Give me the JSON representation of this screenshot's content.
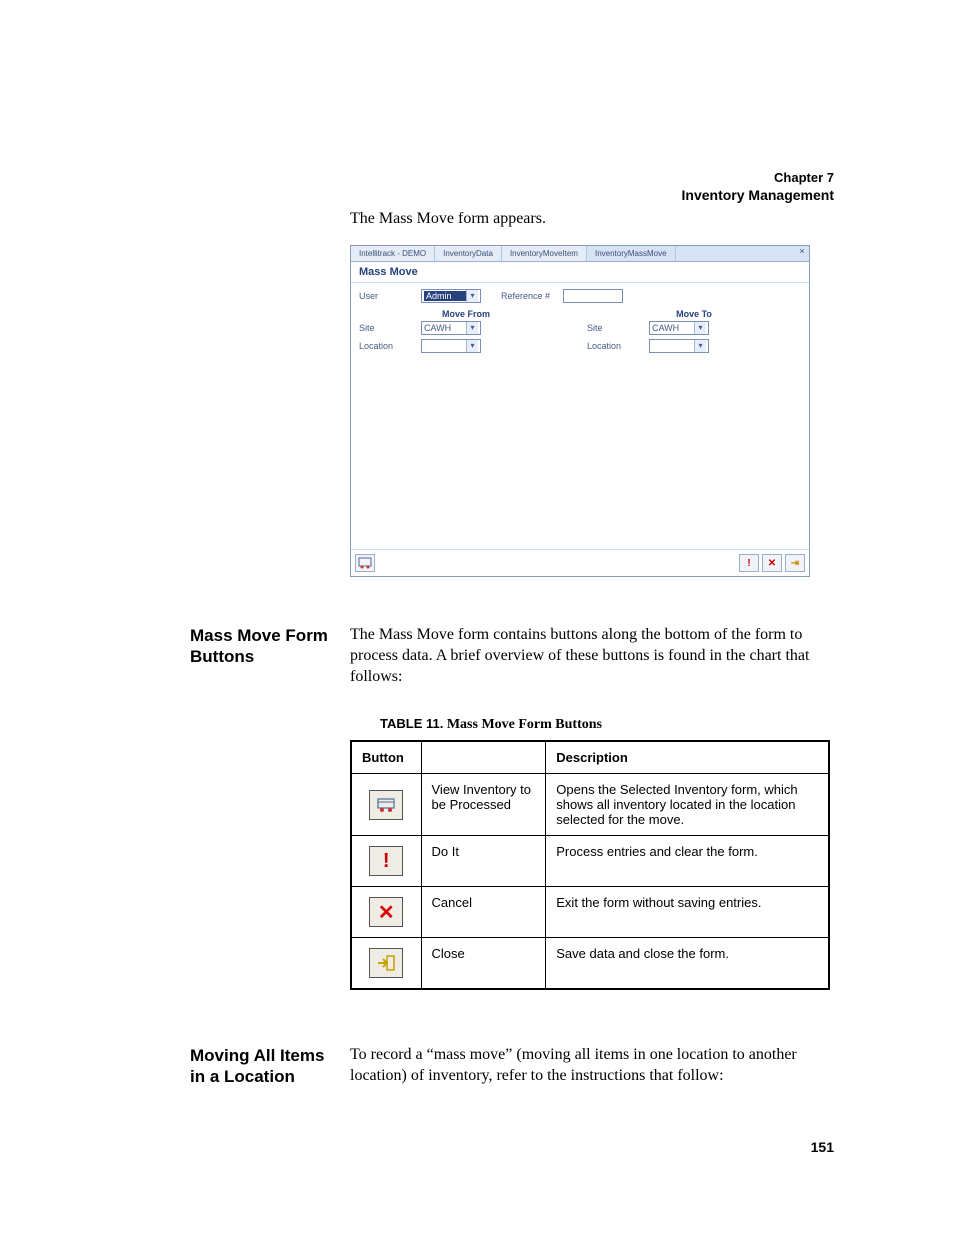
{
  "header": {
    "line1": "Chapter 7",
    "line2": "Inventory Management"
  },
  "intro_text": "The Mass Move form appears.",
  "screenshot": {
    "tabs": [
      "Intellitrack - DEMO",
      "InventoryData",
      "InventoryMoveItem",
      "InventoryMassMove"
    ],
    "active_tab_index": 3,
    "title": "Mass Move",
    "fields": {
      "user_label": "User",
      "user_value": "Admin",
      "reference_label": "Reference #",
      "move_from_label": "Move From",
      "move_to_label": "Move To",
      "site_label": "Site",
      "location_label": "Location",
      "site_from_value": "CAWH",
      "site_to_value": "CAWH",
      "location_from_value": "",
      "location_to_value": ""
    },
    "footer_icons": {
      "view": "view-inventory-icon",
      "doit": "do-it-icon",
      "cancel": "cancel-icon",
      "close": "close-icon"
    }
  },
  "section1": {
    "heading": "Mass Move Form Buttons",
    "body": "The Mass Move form contains buttons along the bottom of the form to process data. A brief overview of these buttons is found in the chart that follows:"
  },
  "table": {
    "caption_label": "TABLE 11.",
    "caption_text": "Mass Move Form Buttons",
    "columns": [
      "Button",
      "",
      "Description"
    ],
    "rows": [
      {
        "icon": "view",
        "name": "View Inventory to be Processed",
        "description": "Opens the Selected Inventory form, which shows all inventory located in the location selected for the move."
      },
      {
        "icon": "doit",
        "name": "Do It",
        "description": "Process entries and clear the form."
      },
      {
        "icon": "cancel",
        "name": "Cancel",
        "description": "Exit the form without saving entries."
      },
      {
        "icon": "close",
        "name": "Close",
        "description": "Save data and close the form."
      }
    ]
  },
  "section2": {
    "heading": "Moving All Items in a Location",
    "body": "To record a “mass move” (moving all items in one location to another location) of inventory, refer to the instructions that follow:"
  },
  "page_number": "151"
}
